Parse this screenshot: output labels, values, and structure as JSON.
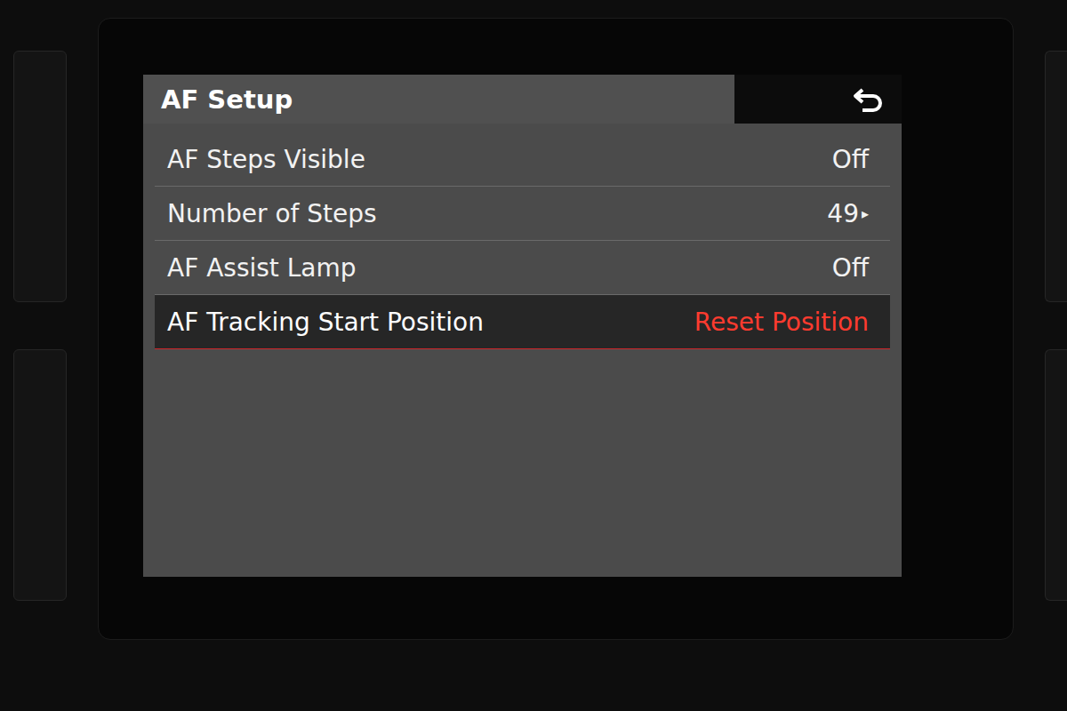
{
  "screen": {
    "title": "AF Setup"
  },
  "rows": [
    {
      "label": "AF Steps Visible",
      "value": "Off",
      "selected": false
    },
    {
      "label": "Number of Steps",
      "value": "49",
      "marker": "▸",
      "selected": false
    },
    {
      "label": "AF Assist Lamp",
      "value": "Off",
      "selected": false
    },
    {
      "label": "AF Tracking Start Position",
      "value": "Reset Position",
      "selected": true
    }
  ]
}
